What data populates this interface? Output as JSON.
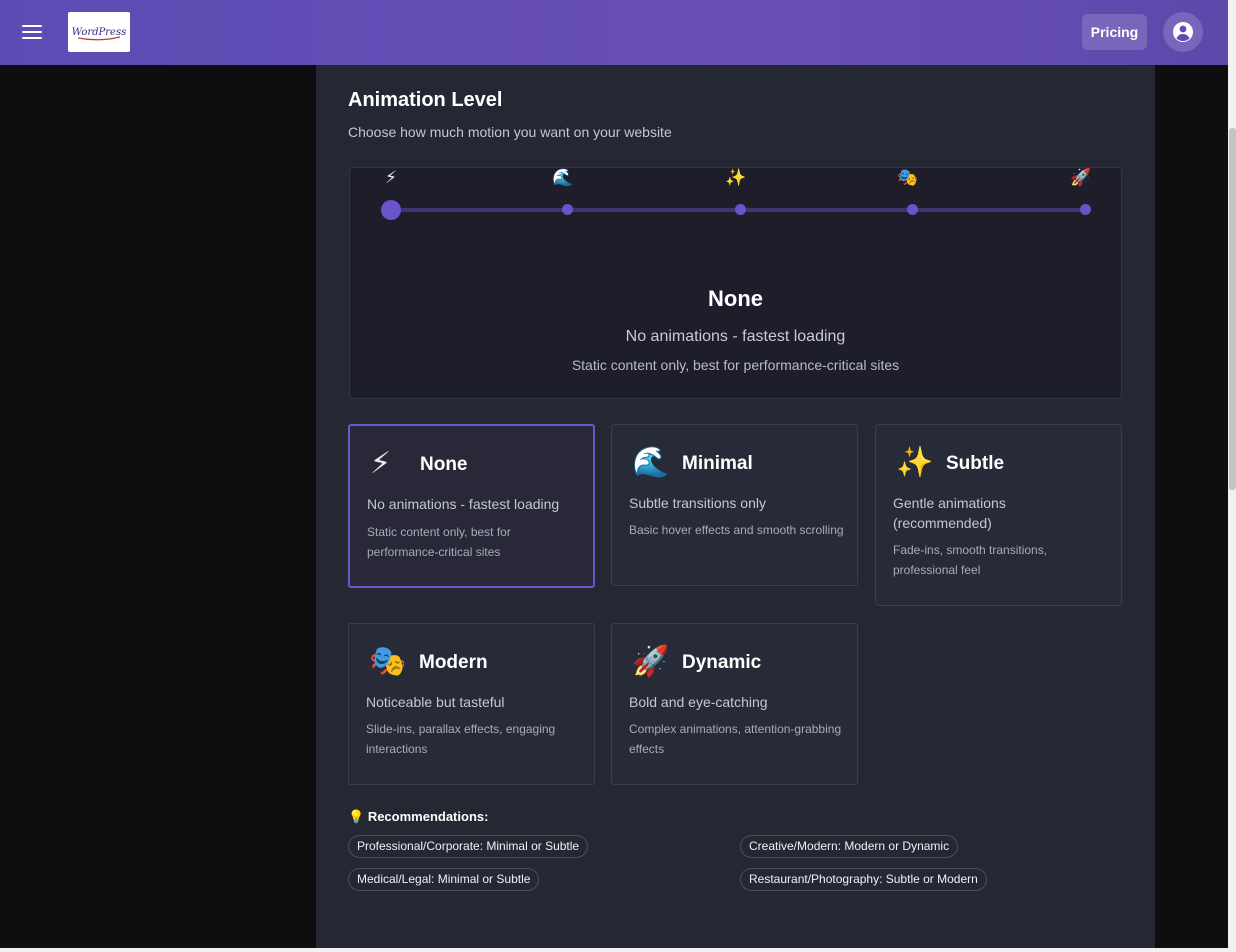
{
  "header": {
    "logo_text": "WordPress",
    "pricing_label": "Pricing"
  },
  "section": {
    "title": "Animation Level",
    "subtitle": "Choose how much motion you want on your website"
  },
  "slider": {
    "selected_index": 0,
    "levels": [
      {
        "icon": "⚡",
        "icon_name": "lightning-icon"
      },
      {
        "icon": "🌊",
        "icon_name": "wave-icon"
      },
      {
        "icon": "✨",
        "icon_name": "sparkles-icon"
      },
      {
        "icon": "🎭",
        "icon_name": "theater-masks-icon"
      },
      {
        "icon": "🚀",
        "icon_name": "rocket-icon"
      }
    ]
  },
  "preview": {
    "title": "None",
    "description": "No animations - fastest loading",
    "detail": "Static content only, best for performance-critical sites"
  },
  "options": [
    {
      "icon": "⚡",
      "title": "None",
      "description": "No animations - fastest loading",
      "detail": "Static content only, best for performance-critical sites",
      "selected": true
    },
    {
      "icon": "🌊",
      "title": "Minimal",
      "description": "Subtle transitions only",
      "detail": "Basic hover effects and smooth scrolling",
      "selected": false
    },
    {
      "icon": "✨",
      "title": "Subtle",
      "description": "Gentle animations (recommended)",
      "detail": "Fade-ins, smooth transitions, professional feel",
      "selected": false
    },
    {
      "icon": "🎭",
      "title": "Modern",
      "description": "Noticeable but tasteful",
      "detail": "Slide-ins, parallax effects, engaging interactions",
      "selected": false
    },
    {
      "icon": "🚀",
      "title": "Dynamic",
      "description": "Bold and eye-catching",
      "detail": "Complex animations, attention-grabbing effects",
      "selected": false
    }
  ],
  "recommendations": {
    "icon": "💡",
    "title": "Recommendations:",
    "items": [
      "Professional/Corporate: Minimal or Subtle",
      "Creative/Modern: Modern or Dynamic",
      "Medical/Legal: Minimal or Subtle",
      "Restaurant/Photography: Subtle or Modern"
    ]
  },
  "colors": {
    "header_bg": "#5b4cb3",
    "accent": "#6c56c9",
    "panel_bg": "#252733"
  }
}
